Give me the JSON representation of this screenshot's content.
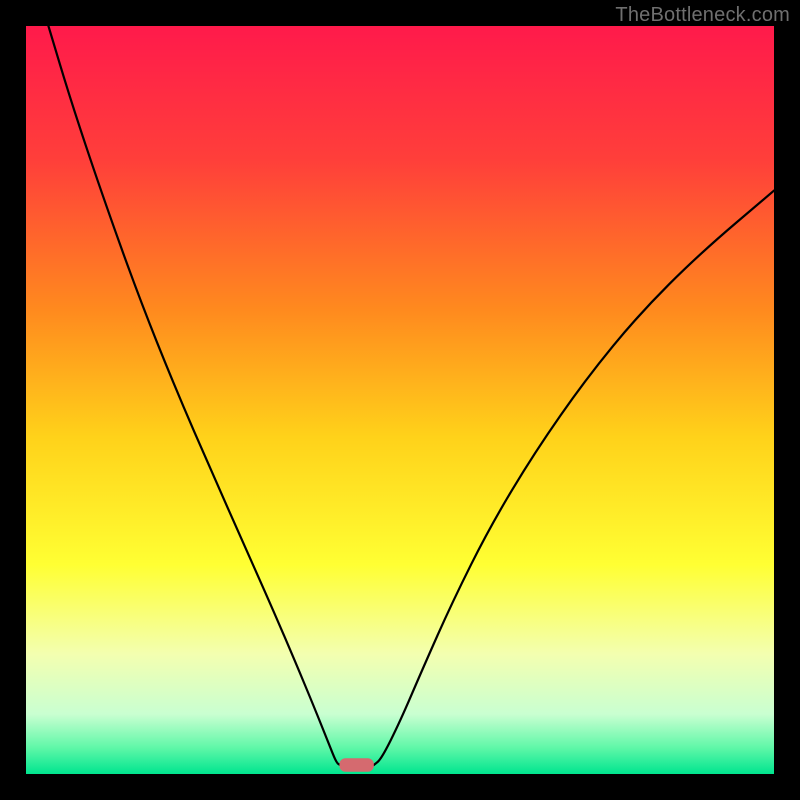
{
  "watermark": "TheBottleneck.com",
  "chart_data": {
    "type": "line",
    "title": "",
    "xlabel": "",
    "ylabel": "",
    "xlim": [
      0,
      100
    ],
    "ylim": [
      0,
      100
    ],
    "background_gradient": {
      "stops": [
        {
          "offset": 0.0,
          "color": "#ff1a4b"
        },
        {
          "offset": 0.18,
          "color": "#ff3f3a"
        },
        {
          "offset": 0.38,
          "color": "#ff8a1e"
        },
        {
          "offset": 0.55,
          "color": "#ffd21a"
        },
        {
          "offset": 0.72,
          "color": "#ffff33"
        },
        {
          "offset": 0.84,
          "color": "#f3ffb0"
        },
        {
          "offset": 0.92,
          "color": "#c9ffd1"
        },
        {
          "offset": 0.965,
          "color": "#5ff7a8"
        },
        {
          "offset": 1.0,
          "color": "#00e58f"
        }
      ]
    },
    "series": [
      {
        "name": "left-curve",
        "color": "#000000",
        "stroke_width": 2.2,
        "points": [
          {
            "x": 3.0,
            "y": 100.0
          },
          {
            "x": 6.0,
            "y": 90.0
          },
          {
            "x": 10.0,
            "y": 78.0
          },
          {
            "x": 15.0,
            "y": 64.0
          },
          {
            "x": 20.0,
            "y": 51.5
          },
          {
            "x": 25.0,
            "y": 40.0
          },
          {
            "x": 29.0,
            "y": 31.0
          },
          {
            "x": 33.0,
            "y": 22.0
          },
          {
            "x": 36.0,
            "y": 15.0
          },
          {
            "x": 38.5,
            "y": 9.0
          },
          {
            "x": 40.5,
            "y": 4.0
          },
          {
            "x": 41.5,
            "y": 1.5
          },
          {
            "x": 42.0,
            "y": 1.2
          }
        ]
      },
      {
        "name": "right-curve",
        "color": "#000000",
        "stroke_width": 2.2,
        "points": [
          {
            "x": 46.5,
            "y": 1.2
          },
          {
            "x": 47.5,
            "y": 2.0
          },
          {
            "x": 50.0,
            "y": 7.0
          },
          {
            "x": 53.0,
            "y": 14.0
          },
          {
            "x": 57.0,
            "y": 23.0
          },
          {
            "x": 62.0,
            "y": 33.0
          },
          {
            "x": 68.0,
            "y": 43.0
          },
          {
            "x": 75.0,
            "y": 53.0
          },
          {
            "x": 82.0,
            "y": 61.5
          },
          {
            "x": 90.0,
            "y": 69.5
          },
          {
            "x": 100.0,
            "y": 78.0
          }
        ]
      }
    ],
    "marker": {
      "name": "baseline-pill",
      "x_center": 44.2,
      "width": 4.6,
      "y": 1.2,
      "height": 1.8,
      "fill": "#d56a6f",
      "rx": 6
    }
  }
}
